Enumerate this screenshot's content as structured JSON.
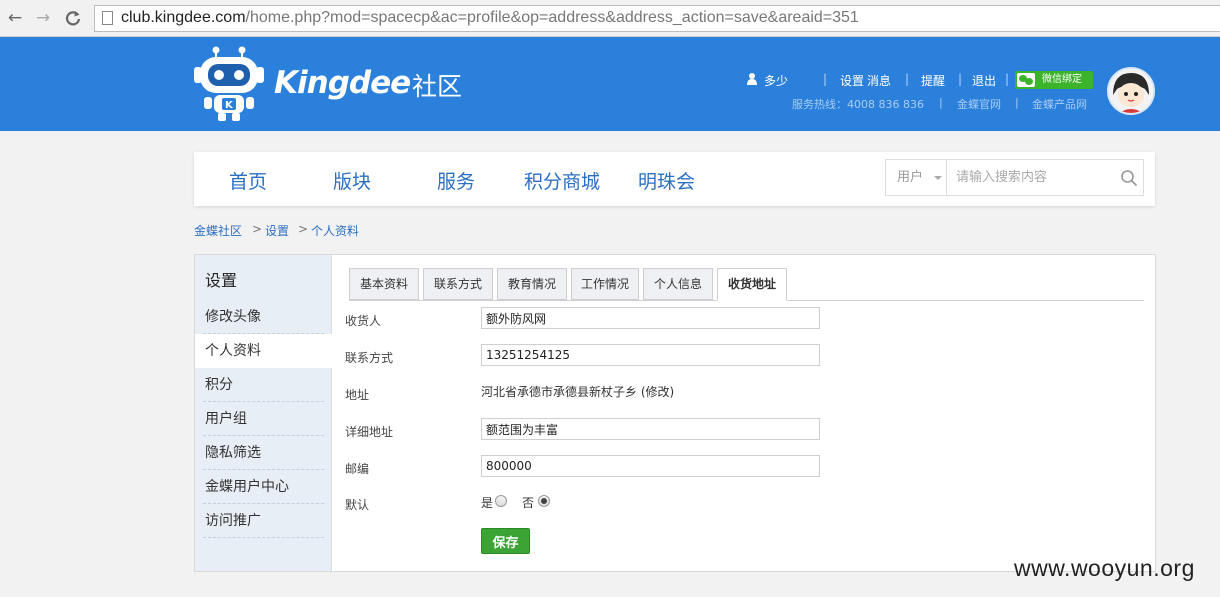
{
  "browser": {
    "url_domain": "club.kingdee.com",
    "url_path": "/home.php?mod=spacecp&ac=profile&op=address&address_action=save&areaid=351",
    "back": "←",
    "forward": "→",
    "reload": "C"
  },
  "header": {
    "brand": "Kingdee",
    "brand_cn": "社区",
    "username": "多少",
    "settings": "设置",
    "messages": "消息",
    "remind": "提醒",
    "logout": "退出",
    "wechat_bind": "微信绑定",
    "sep": "|",
    "hotline": "服务热线：4008 836 836",
    "official_site": "金蝶官网",
    "product_site": "金蝶产品网",
    "colors": {
      "header_bg": "#2b80dc",
      "wechat_bg": "#3bb32b"
    }
  },
  "nav": {
    "items": [
      "首页",
      "版块",
      "服务",
      "积分商城",
      "明珠会"
    ],
    "search_type": "用户",
    "search_placeholder": "请输入搜索内容"
  },
  "breadcrumb": {
    "items": [
      "金蝶社区",
      "设置",
      "个人资料"
    ],
    "chevron": ">"
  },
  "sidebar": {
    "title": "设置",
    "items": [
      "修改头像",
      "个人资料",
      "积分",
      "用户组",
      "隐私筛选",
      "金蝶用户中心",
      "访问推广"
    ],
    "active": "个人资料"
  },
  "tabs": {
    "items": [
      "基本资料",
      "联系方式",
      "教育情况",
      "工作情况",
      "个人信息",
      "收货地址"
    ],
    "active": "收货地址"
  },
  "form": {
    "receiver_label": "收货人",
    "receiver_value": "额外防风网",
    "contact_label": "联系方式",
    "contact_value": "13251254125",
    "address_label": "地址",
    "address_value": "河北省承德市承德县新杖子乡",
    "address_edit": "(修改)",
    "detail_label": "详细地址",
    "detail_value": "额范围为丰富",
    "zip_label": "邮编",
    "zip_value": "800000",
    "default_label": "默认",
    "yes_label": "是",
    "no_label": "否",
    "default_selected": "否",
    "save_label": "保存"
  },
  "watermark": "www.wooyun.org"
}
